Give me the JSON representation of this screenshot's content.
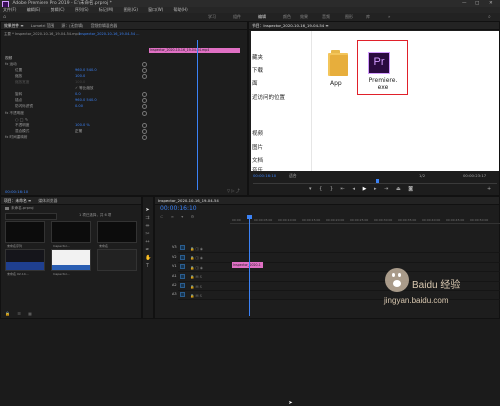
{
  "title": "Adobe Premiere Pro 2019 - E:\\未命名.prproj *",
  "menu": [
    "文件(F)",
    "编辑(E)",
    "剪辑(C)",
    "序列(S)",
    "标记(M)",
    "图形(G)",
    "窗口(W)",
    "帮助(H)"
  ],
  "workspaces": [
    "学习",
    "组件",
    "编辑",
    "颜色",
    "效果",
    "音频",
    "图形",
    "库"
  ],
  "source_tabs": [
    "效果控件 ≡",
    "Lumetri 范围",
    "源：(无剪辑)",
    "音频剪辑混合器"
  ],
  "ec_header": {
    "master": "主要 * Inspector_2020-10-16_19-04-54.mp4",
    "clip": "Inspector_2020-10-16_19-04-54 ...",
    "clip_bar": "Inspector_2020-10-16_19-04-54.mp4"
  },
  "ec_props": [
    {
      "label": "视频",
      "val": ""
    },
    {
      "label": "fx  运动",
      "val": ""
    },
    {
      "label": "位置",
      "val": "960.0    540.0"
    },
    {
      "label": "缩放",
      "val": "100.0"
    },
    {
      "label": "缩放宽度",
      "val": "100.0"
    },
    {
      "label": "",
      "val": "✓ 等比缩放"
    },
    {
      "label": "旋转",
      "val": "0.0"
    },
    {
      "label": "锚点",
      "val": "960.0    540.0"
    },
    {
      "label": "防闪烁滤镜",
      "val": "0.00"
    },
    {
      "label": "fx  不透明度",
      "val": ""
    },
    {
      "label": "",
      "val": ""
    },
    {
      "label": "不透明度",
      "val": "100.0 %"
    },
    {
      "label": "混合模式",
      "val": "正常"
    },
    {
      "label": "fx  时间重映射",
      "val": ""
    }
  ],
  "ec_timecode": "00:00:16:10",
  "program": {
    "sidebar": [
      "藏夹",
      "下载",
      "面",
      "近访问的位置",
      "",
      "",
      "视频",
      "图片",
      "文档",
      "音乐"
    ],
    "files": [
      {
        "name": "App",
        "icon": "folder-icon"
      },
      {
        "name": "Premiere.\nexe",
        "icon": "premiere-app-icon"
      }
    ],
    "timecode_left": "00:00:16:10",
    "fit": "适合",
    "quality": "1/2",
    "timecode_right": "00:00:23:17"
  },
  "project": {
    "tabs": [
      "项目：未命名 ≡",
      "媒体浏览器"
    ],
    "file": "未命名.prproj",
    "count": "1 项已选择，共 6 项",
    "thumbs": [
      {
        "label": "未命名序列"
      },
      {
        "label": "Inspector..."
      },
      {
        "label": "未命名"
      },
      {
        "label": "未命名 02-14..."
      },
      {
        "label": "Inspector..."
      },
      {
        "label": ""
      }
    ]
  },
  "timeline": {
    "tab": "Inspector_2020-10-16_19-04-54",
    "timecode": "00:00:16:10",
    "ticks": [
      "00:00",
      "00:00:05:00",
      "00:00:10:00",
      "00:00:15:00",
      "00:00:20:00",
      "00:00:25:00",
      "00:00:30:00",
      "00:00:35:00",
      "00:00:40:00",
      "00:00:45:00",
      "00:00:50:00"
    ],
    "tracks": [
      "V3",
      "V2",
      "V1",
      "A1",
      "A2",
      "A3"
    ],
    "clip": "Inspector_2020-1"
  },
  "watermark": {
    "line1": "Baidu 经验",
    "line2": "jingyan.baidu.com"
  },
  "colors": {
    "accent": "#3b82f6",
    "clip": "#e070c4",
    "highlight": "#e0202a",
    "premiere": "#2a0a3f"
  }
}
